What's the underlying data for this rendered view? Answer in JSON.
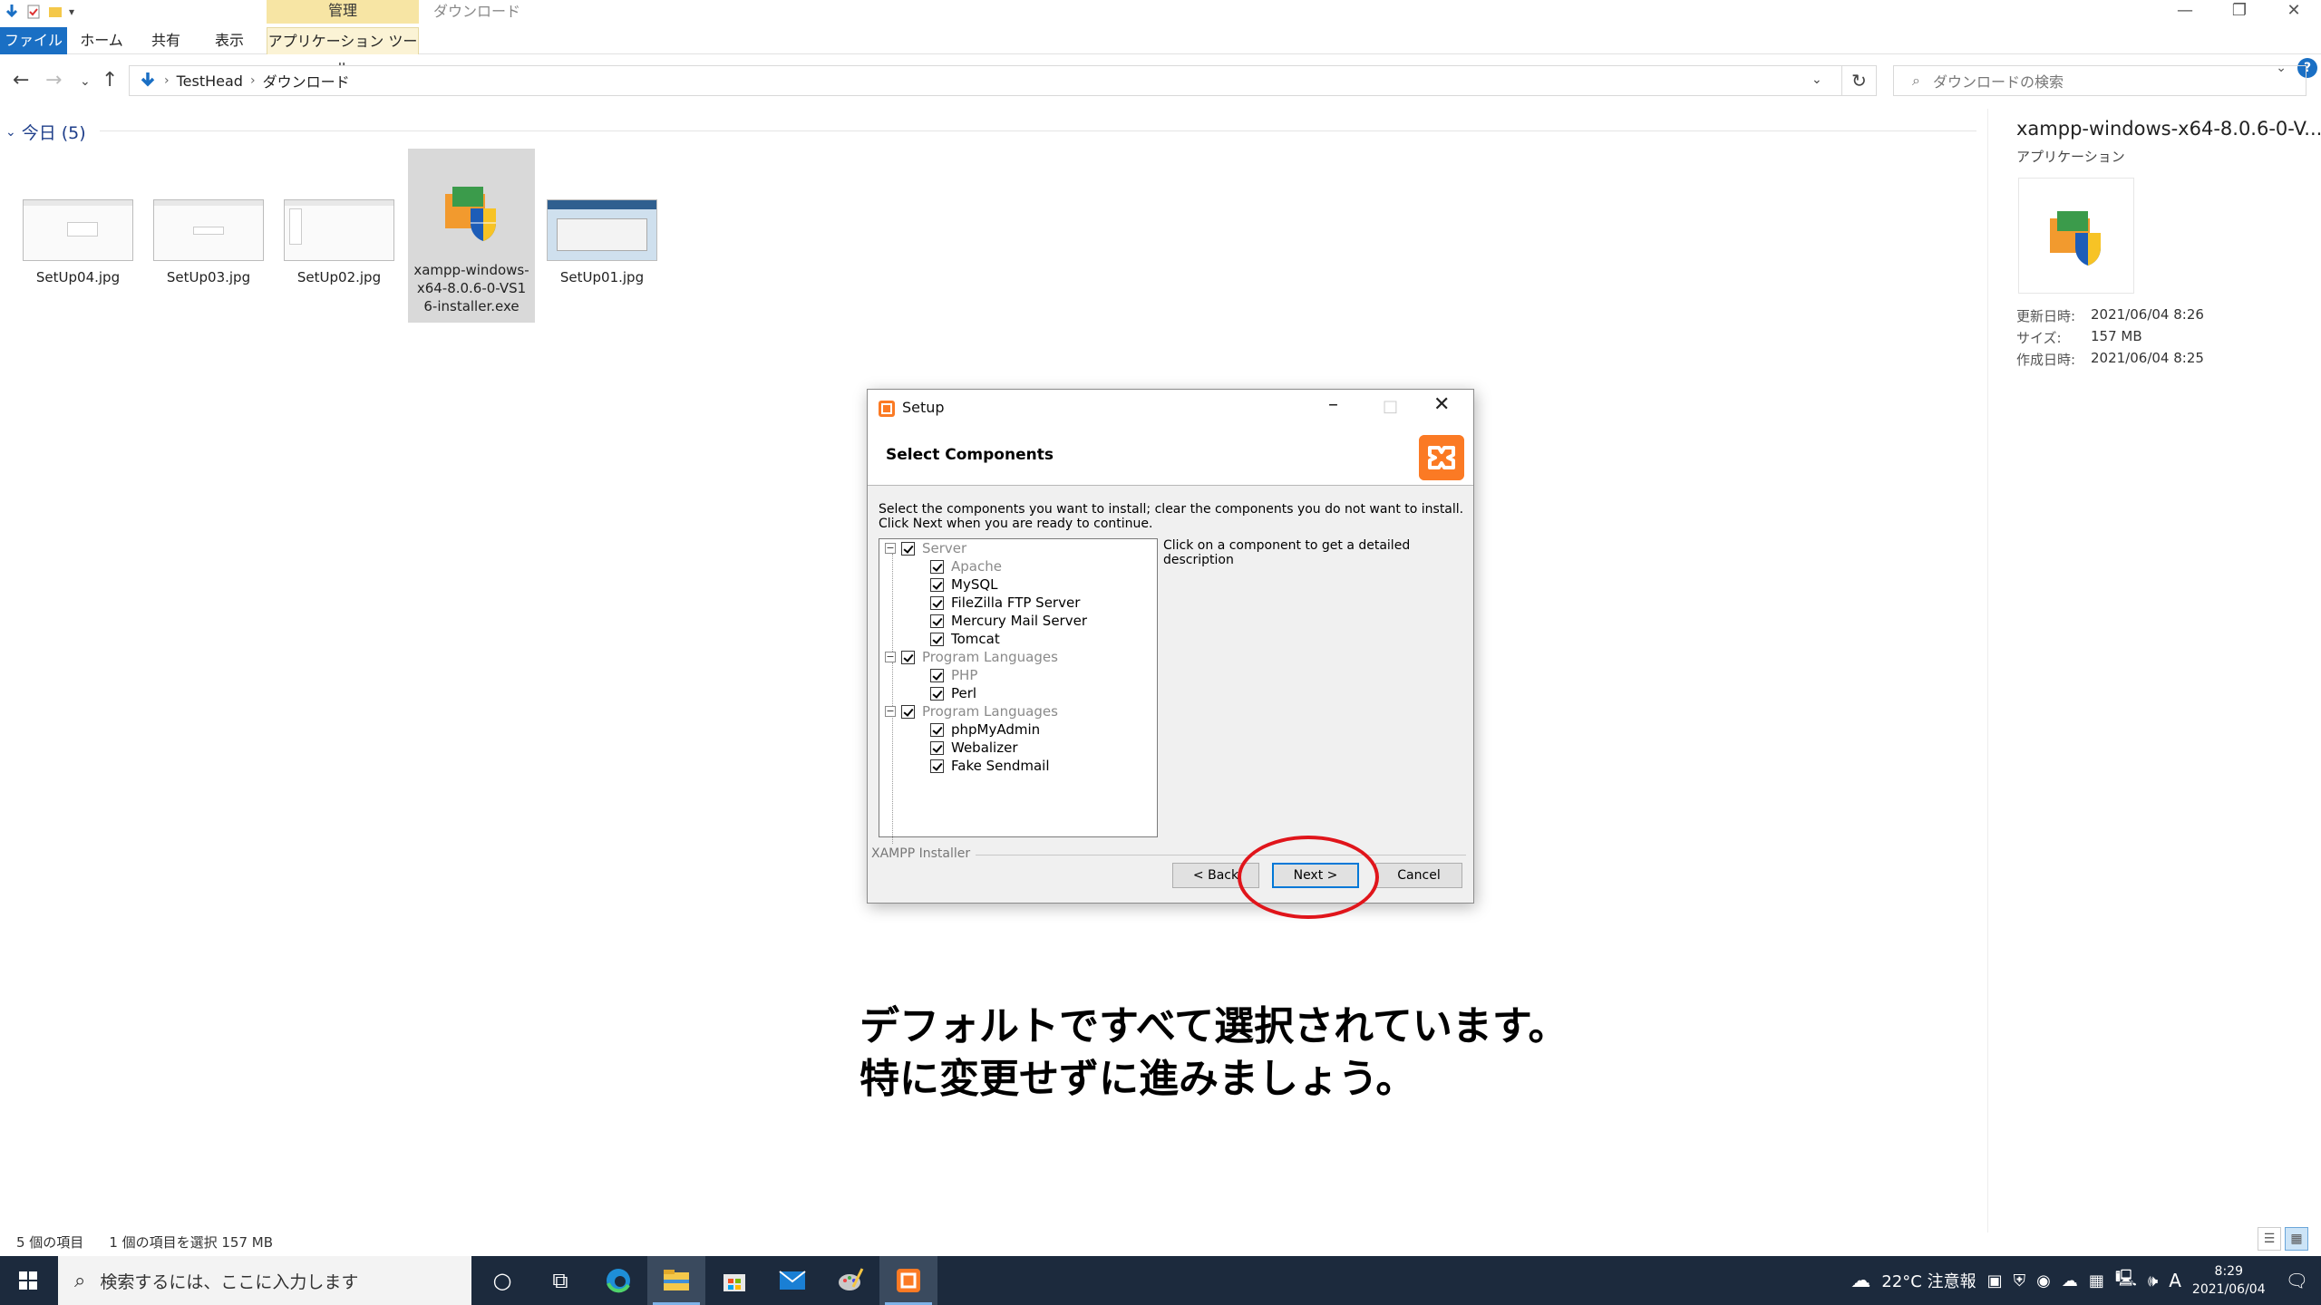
{
  "ribbon": {
    "context_group": "管理",
    "context_title": "ダウンロード",
    "tabs": [
      "ファイル",
      "ホーム",
      "共有",
      "表示"
    ],
    "context_tab": "アプリケーション ツール"
  },
  "address": {
    "crumbs": [
      "TestHead",
      "ダウンロード"
    ],
    "search_placeholder": "ダウンロードの検索"
  },
  "group": {
    "label": "今日 (5)"
  },
  "files": [
    {
      "name": "SetUp04.jpg"
    },
    {
      "name": "SetUp03.jpg"
    },
    {
      "name": "SetUp02.jpg"
    },
    {
      "name": "xampp-windows-x64-8.0.6-0-VS16-installer.exe",
      "selected": true
    },
    {
      "name": "SetUp01.jpg"
    }
  ],
  "preview": {
    "title": "xampp-windows-x64-8.0.6-0-V...",
    "type": "アプリケーション",
    "props": [
      {
        "label": "更新日時:",
        "value": "2021/06/04 8:26"
      },
      {
        "label": "サイズ:",
        "value": "157 MB"
      },
      {
        "label": "作成日時:",
        "value": "2021/06/04 8:25"
      }
    ]
  },
  "dialog": {
    "title": "Setup",
    "heading": "Select Components",
    "instructions": "Select the components you want to install; clear the components you do not want to install. Click Next when you are ready to continue.",
    "description_hint": "Click on a component to get a detailed description",
    "tree": [
      {
        "label": "Server",
        "level": 0,
        "dim": true
      },
      {
        "label": "Apache",
        "level": 1,
        "dim": true
      },
      {
        "label": "MySQL",
        "level": 1
      },
      {
        "label": "FileZilla FTP Server",
        "level": 1
      },
      {
        "label": "Mercury Mail Server",
        "level": 1
      },
      {
        "label": "Tomcat",
        "level": 1
      },
      {
        "label": "Program Languages",
        "level": 0,
        "dim": true
      },
      {
        "label": "PHP",
        "level": 1,
        "dim": true
      },
      {
        "label": "Perl",
        "level": 1
      },
      {
        "label": "Program Languages",
        "level": 0,
        "dim": true
      },
      {
        "label": "phpMyAdmin",
        "level": 1
      },
      {
        "label": "Webalizer",
        "level": 1
      },
      {
        "label": "Fake Sendmail",
        "level": 1
      }
    ],
    "group_label": "XAMPP Installer",
    "back_label": "< Back",
    "next_label": "Next >",
    "cancel_label": "Cancel"
  },
  "caption": {
    "line1": "デフォルトですべて選択されています。",
    "line2": "特に変更せずに進みましょう。"
  },
  "statusbar": {
    "item_count": "5 個の項目",
    "selection": "1 個の項目を選択  157 MB"
  },
  "taskbar": {
    "search_placeholder": "検索するには、ここに入力します",
    "weather": "22°C  注意報",
    "ime": "A",
    "time": "8:29",
    "date": "2021/06/04"
  },
  "colors": {
    "accent": "#1a6fc4",
    "xampp_orange": "#fb7a24",
    "highlight_ring": "#e0151b",
    "taskbar": "#1c2a3d"
  }
}
